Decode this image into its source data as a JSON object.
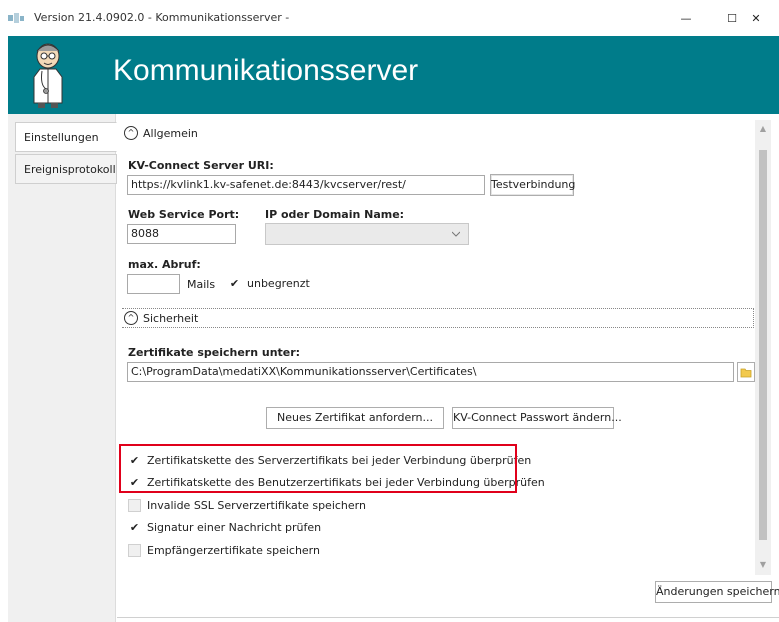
{
  "window": {
    "title": "Version 21.4.0902.0 - Kommunikationsserver -",
    "minimize_glyph": "—",
    "maximize_glyph": "☐",
    "close_glyph": "✕"
  },
  "header": {
    "title": "Kommunikationsserver",
    "color": "#007c8a"
  },
  "sidebar": {
    "tabs": [
      {
        "label": "Einstellungen",
        "active": true
      },
      {
        "label": "Ereignisprotokoll",
        "active": false
      }
    ]
  },
  "allgemein": {
    "section_label": "Allgemein",
    "kv_uri_label": "KV-Connect Server URI:",
    "kv_uri_value": "https://kvlink1.kv-safenet.de:8443/kvcserver/rest/",
    "test_button": "Testverbindung",
    "port_label": "Web Service Port:",
    "port_value": "8088",
    "ip_label": "IP oder Domain Name:",
    "ip_value": "",
    "max_abruf_label": "max. Abruf:",
    "max_abruf_value": "",
    "mails_label": "Mails",
    "unbegrenzt_label": "unbegrenzt",
    "unbegrenzt_checked": true
  },
  "sicherheit": {
    "section_label": "Sicherheit",
    "cert_path_label": "Zertifikate speichern unter:",
    "cert_path_value": "C:\\ProgramData\\medatiXX\\Kommunikationsserver\\Certificates\\",
    "new_cert_button": "Neues Zertifikat anfordern...",
    "change_pw_button": "KV-Connect Passwort ändern...",
    "options": [
      {
        "label": "Zertifikatskette des Serverzertifikats bei jeder Verbindung überprüfen",
        "checked": true
      },
      {
        "label": "Zertifikatskette des Benutzerzertifikats bei jeder Verbindung überprüfen",
        "checked": true
      },
      {
        "label": "Invalide SSL Serverzertifikate speichern",
        "checked": false
      },
      {
        "label": "Signatur einer Nachricht prüfen",
        "checked": true
      },
      {
        "label": "Empfängerzertifikate speichern",
        "checked": false
      }
    ]
  },
  "footer": {
    "save_button": "Änderungen speichern"
  },
  "check_glyph": "✔",
  "highlight_color": "#e0001b"
}
